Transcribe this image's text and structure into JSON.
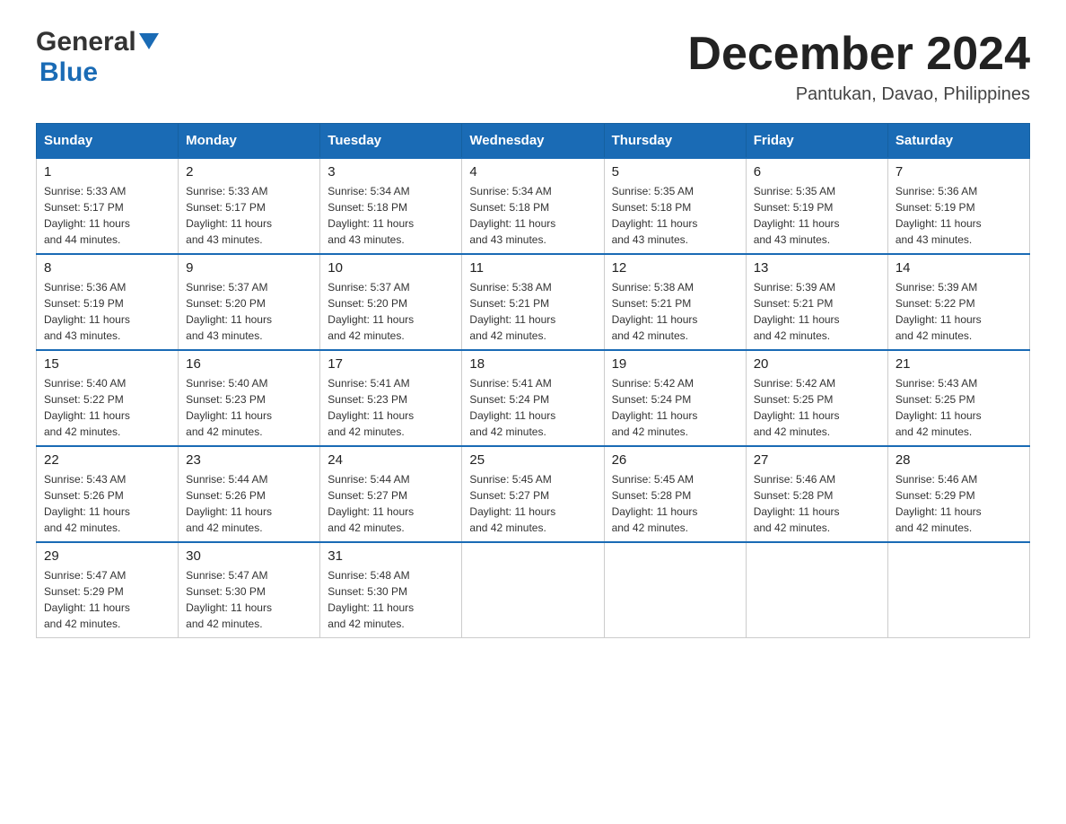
{
  "header": {
    "logo_general": "General",
    "logo_blue": "Blue",
    "month_title": "December 2024",
    "location": "Pantukan, Davao, Philippines"
  },
  "days_of_week": [
    "Sunday",
    "Monday",
    "Tuesday",
    "Wednesday",
    "Thursday",
    "Friday",
    "Saturday"
  ],
  "weeks": [
    [
      {
        "day": "1",
        "sunrise": "5:33 AM",
        "sunset": "5:17 PM",
        "daylight": "11 hours and 44 minutes."
      },
      {
        "day": "2",
        "sunrise": "5:33 AM",
        "sunset": "5:17 PM",
        "daylight": "11 hours and 43 minutes."
      },
      {
        "day": "3",
        "sunrise": "5:34 AM",
        "sunset": "5:18 PM",
        "daylight": "11 hours and 43 minutes."
      },
      {
        "day": "4",
        "sunrise": "5:34 AM",
        "sunset": "5:18 PM",
        "daylight": "11 hours and 43 minutes."
      },
      {
        "day": "5",
        "sunrise": "5:35 AM",
        "sunset": "5:18 PM",
        "daylight": "11 hours and 43 minutes."
      },
      {
        "day": "6",
        "sunrise": "5:35 AM",
        "sunset": "5:19 PM",
        "daylight": "11 hours and 43 minutes."
      },
      {
        "day": "7",
        "sunrise": "5:36 AM",
        "sunset": "5:19 PM",
        "daylight": "11 hours and 43 minutes."
      }
    ],
    [
      {
        "day": "8",
        "sunrise": "5:36 AM",
        "sunset": "5:19 PM",
        "daylight": "11 hours and 43 minutes."
      },
      {
        "day": "9",
        "sunrise": "5:37 AM",
        "sunset": "5:20 PM",
        "daylight": "11 hours and 43 minutes."
      },
      {
        "day": "10",
        "sunrise": "5:37 AM",
        "sunset": "5:20 PM",
        "daylight": "11 hours and 42 minutes."
      },
      {
        "day": "11",
        "sunrise": "5:38 AM",
        "sunset": "5:21 PM",
        "daylight": "11 hours and 42 minutes."
      },
      {
        "day": "12",
        "sunrise": "5:38 AM",
        "sunset": "5:21 PM",
        "daylight": "11 hours and 42 minutes."
      },
      {
        "day": "13",
        "sunrise": "5:39 AM",
        "sunset": "5:21 PM",
        "daylight": "11 hours and 42 minutes."
      },
      {
        "day": "14",
        "sunrise": "5:39 AM",
        "sunset": "5:22 PM",
        "daylight": "11 hours and 42 minutes."
      }
    ],
    [
      {
        "day": "15",
        "sunrise": "5:40 AM",
        "sunset": "5:22 PM",
        "daylight": "11 hours and 42 minutes."
      },
      {
        "day": "16",
        "sunrise": "5:40 AM",
        "sunset": "5:23 PM",
        "daylight": "11 hours and 42 minutes."
      },
      {
        "day": "17",
        "sunrise": "5:41 AM",
        "sunset": "5:23 PM",
        "daylight": "11 hours and 42 minutes."
      },
      {
        "day": "18",
        "sunrise": "5:41 AM",
        "sunset": "5:24 PM",
        "daylight": "11 hours and 42 minutes."
      },
      {
        "day": "19",
        "sunrise": "5:42 AM",
        "sunset": "5:24 PM",
        "daylight": "11 hours and 42 minutes."
      },
      {
        "day": "20",
        "sunrise": "5:42 AM",
        "sunset": "5:25 PM",
        "daylight": "11 hours and 42 minutes."
      },
      {
        "day": "21",
        "sunrise": "5:43 AM",
        "sunset": "5:25 PM",
        "daylight": "11 hours and 42 minutes."
      }
    ],
    [
      {
        "day": "22",
        "sunrise": "5:43 AM",
        "sunset": "5:26 PM",
        "daylight": "11 hours and 42 minutes."
      },
      {
        "day": "23",
        "sunrise": "5:44 AM",
        "sunset": "5:26 PM",
        "daylight": "11 hours and 42 minutes."
      },
      {
        "day": "24",
        "sunrise": "5:44 AM",
        "sunset": "5:27 PM",
        "daylight": "11 hours and 42 minutes."
      },
      {
        "day": "25",
        "sunrise": "5:45 AM",
        "sunset": "5:27 PM",
        "daylight": "11 hours and 42 minutes."
      },
      {
        "day": "26",
        "sunrise": "5:45 AM",
        "sunset": "5:28 PM",
        "daylight": "11 hours and 42 minutes."
      },
      {
        "day": "27",
        "sunrise": "5:46 AM",
        "sunset": "5:28 PM",
        "daylight": "11 hours and 42 minutes."
      },
      {
        "day": "28",
        "sunrise": "5:46 AM",
        "sunset": "5:29 PM",
        "daylight": "11 hours and 42 minutes."
      }
    ],
    [
      {
        "day": "29",
        "sunrise": "5:47 AM",
        "sunset": "5:29 PM",
        "daylight": "11 hours and 42 minutes."
      },
      {
        "day": "30",
        "sunrise": "5:47 AM",
        "sunset": "5:30 PM",
        "daylight": "11 hours and 42 minutes."
      },
      {
        "day": "31",
        "sunrise": "5:48 AM",
        "sunset": "5:30 PM",
        "daylight": "11 hours and 42 minutes."
      },
      null,
      null,
      null,
      null
    ]
  ]
}
